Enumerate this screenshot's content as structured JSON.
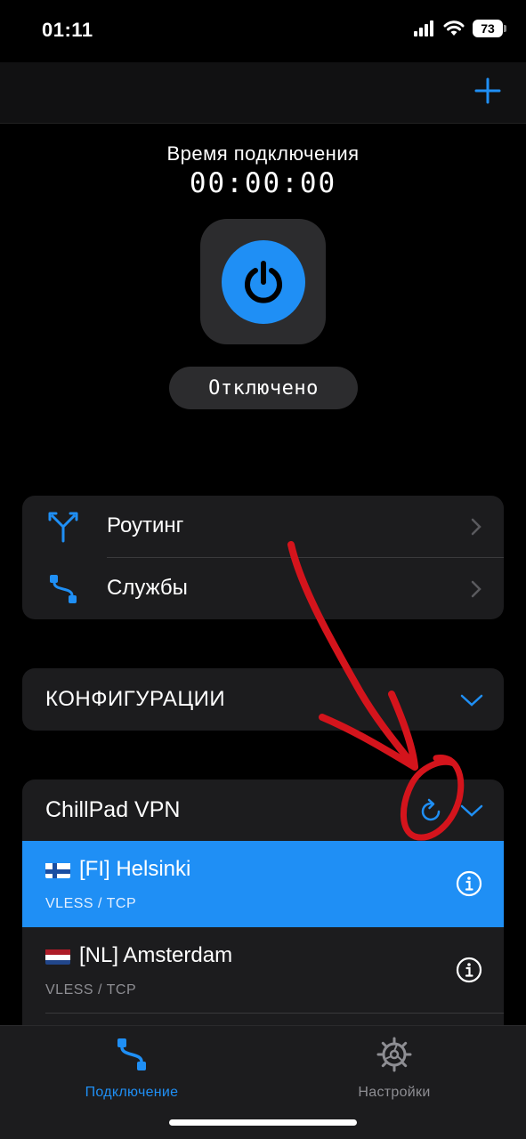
{
  "status_bar": {
    "time": "01:11",
    "battery": "73"
  },
  "nav_bar": {
    "add_icon": "plus-icon"
  },
  "connection": {
    "label": "Время подключения",
    "timer": "00:00:00",
    "state": "Отключено",
    "power_icon": "power-icon"
  },
  "menu": {
    "items": [
      {
        "label": "Роутинг",
        "icon": "routing-icon"
      },
      {
        "label": "Службы",
        "icon": "services-icon"
      }
    ]
  },
  "configurations": {
    "title": "КОНФИГУРАЦИИ"
  },
  "subscription": {
    "title": "ChillPad VPN",
    "servers": [
      {
        "country": "FI",
        "name": "[FI] Helsinki",
        "protocol": "VLESS / TCP",
        "selected": true
      },
      {
        "country": "NL",
        "name": "[NL] Amsterdam",
        "protocol": "VLESS / TCP",
        "selected": false
      }
    ]
  },
  "tab_bar": {
    "tabs": [
      {
        "label": "Подключение",
        "icon": "connection-icon",
        "active": true
      },
      {
        "label": "Настройки",
        "icon": "gear-icon",
        "active": false
      }
    ]
  },
  "colors": {
    "accent": "#1f8ff5",
    "background": "#000000",
    "card": "#1c1c1e",
    "annotation": "#d4141c"
  }
}
